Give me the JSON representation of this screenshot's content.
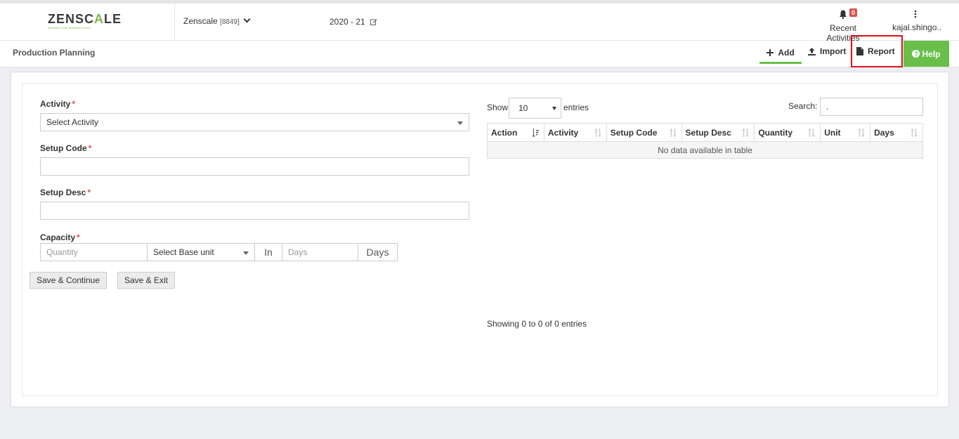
{
  "header": {
    "logo_text_left": "ZENSC",
    "logo_text_accent": "A",
    "logo_text_right": "LE",
    "logo_tagline": "Business Less Business Focus",
    "company_name": "Zenscale",
    "company_code": "[8849]",
    "financial_year": "2020 - 21",
    "notifications_count": "0",
    "recent_activities_label": "Recent Activities",
    "user_name": "kajal.shingo.."
  },
  "subbar": {
    "page_title": "Production Planning",
    "add_label": "Add",
    "import_label": "Import",
    "report_label": "Report",
    "help_label": "Help"
  },
  "form": {
    "activity_label": "Activity",
    "activity_placeholder": "Select Activity",
    "setup_code_label": "Setup Code",
    "setup_desc_label": "Setup Desc",
    "capacity_label": "Capacity",
    "quantity_placeholder": "Quantity",
    "base_unit_placeholder": "Select Base unit",
    "in_label": "In",
    "days_placeholder": "Days",
    "days_addon": "Days",
    "required_mark": "*",
    "save_continue_label": "Save & Continue",
    "save_exit_label": "Save & Exit"
  },
  "datatable": {
    "show_label": "Show",
    "page_length": "10",
    "entries_label": "entries",
    "search_label": "Search:",
    "search_value": ".",
    "columns": [
      "Action",
      "Activity",
      "Setup Code",
      "Setup Desc",
      "Quantity",
      "Unit",
      "Days"
    ],
    "empty_message": "No data available in table",
    "info": "Showing 0 to 0 of 0 entries"
  },
  "colors": {
    "accent_green": "#6abf4b",
    "required_red": "#d9534f",
    "highlight_red": "#e0101a"
  }
}
